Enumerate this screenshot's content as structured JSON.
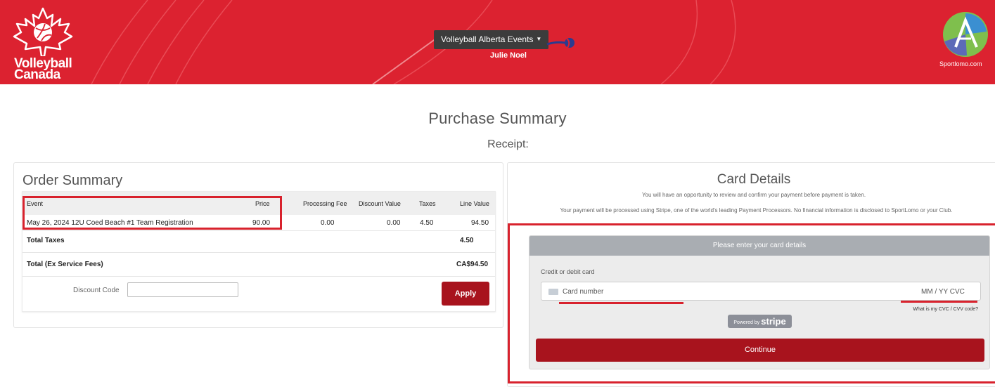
{
  "header": {
    "brand_line1": "Volleyball",
    "brand_line2": "Canada",
    "events_dropdown": "Volleyball Alberta Events",
    "user_name": "Julie Noel",
    "sportlomo_text": "Sportlomo.com",
    "color": "#dc2230"
  },
  "page": {
    "title": "Purchase Summary",
    "subtitle": "Receipt:"
  },
  "order_summary": {
    "title": "Order Summary",
    "columns": [
      "Event",
      "Price",
      "Processing Fee",
      "Discount Value",
      "Taxes",
      "Line Value"
    ],
    "row": {
      "event": "May 26, 2024 12U Coed Beach #1 Team Registration",
      "price": "90.00",
      "processing_fee": "0.00",
      "discount_value": "0.00",
      "taxes": "4.50",
      "line_value": "94.50"
    },
    "total_taxes_label": "Total Taxes",
    "total_taxes_value": "4.50",
    "total_label": "Total (Ex Service Fees)",
    "total_value": "CA$94.50",
    "discount_label": "Discount Code",
    "discount_value": "",
    "apply_label": "Apply"
  },
  "card_details": {
    "title": "Card Details",
    "note1": "You will have an opportunity to review and confirm your payment before payment is taken.",
    "note2": "Your payment will be processed using Stripe, one of the world's leading Payment Processors. No financial information is disclosed to SportLomo or your Club.",
    "stripe_header": "Please enter your card details",
    "card_label": "Credit or debit card",
    "card_placeholder": "Card number",
    "expiry_cvc_placeholder": "MM / YY  CVC",
    "cvc_help": "What is my CVC / CVV code?",
    "powered_by": "Powered by",
    "stripe_brand": "stripe",
    "continue_label": "Continue"
  }
}
